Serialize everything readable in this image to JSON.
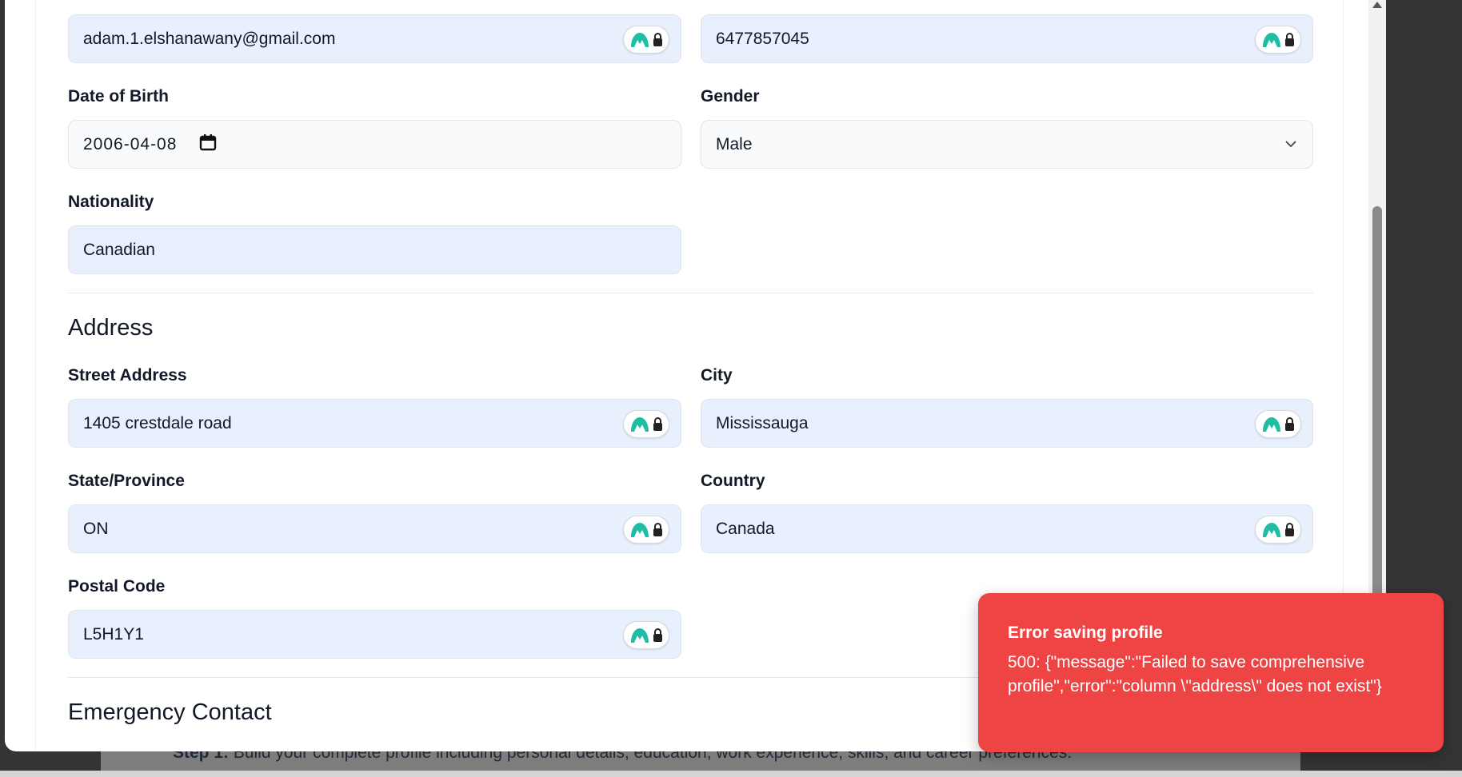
{
  "background": {
    "step_label": "Step 1:",
    "step_text": " Build your complete profile including personal details, education, work experience, skills, and career preferences."
  },
  "personal": {
    "email_value": "adam.1.elshanawany@gmail.com",
    "phone_value": "6477857045",
    "dob_label": "Date of Birth",
    "dob_value": "2006-04-08",
    "gender_label": "Gender",
    "gender_value": "Male",
    "nationality_label": "Nationality",
    "nationality_value": "Canadian"
  },
  "address": {
    "title": "Address",
    "street_label": "Street Address",
    "street_value": "1405 crestdale road",
    "city_label": "City",
    "city_value": "Mississauga",
    "state_label": "State/Province",
    "state_value": "ON",
    "country_label": "Country",
    "country_value": "Canada",
    "postal_label": "Postal Code",
    "postal_value": "L5H1Y1"
  },
  "emergency": {
    "title": "Emergency Contact"
  },
  "toast": {
    "title": "Error saving profile",
    "message": "500: {\"message\":\"Failed to save comprehensive profile\",\"error\":\"column \\\"address\\\" does not exist\"}",
    "color": "#ef4444"
  },
  "icons": {
    "autofill": "password-manager-lock-icon",
    "calendar": "calendar-icon",
    "chevron": "chevron-down-icon"
  },
  "colors": {
    "autofill_bg": "#e8f0fe",
    "manager_green": "#1ebea5"
  }
}
